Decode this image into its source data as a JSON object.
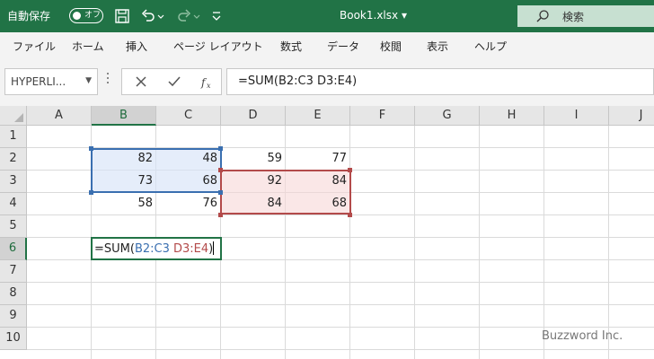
{
  "titlebar": {
    "autosave_label": "自動保存",
    "autosave_state": "オフ",
    "filename": "Book1.xlsx",
    "filename_dropdown": "▾",
    "search_label": "検索",
    "colors": {
      "background": "#217346",
      "text": "#ffffff"
    },
    "icons": [
      "save-icon",
      "undo-icon",
      "undo-dropdown-icon",
      "redo-icon",
      "redo-dropdown-icon",
      "customize-qat-icon",
      "search-icon"
    ]
  },
  "ribbon": {
    "tabs": [
      "ファイル",
      "ホーム",
      "挿入",
      "ページ レイアウト",
      "数式",
      "データ",
      "校閲",
      "表示",
      "ヘルプ"
    ]
  },
  "formula_bar": {
    "name_box": "HYPERLI...",
    "formula": "=SUM(B2:C3 D3:E4)",
    "icons": [
      "cancel-icon",
      "enter-icon",
      "insert-function-icon"
    ]
  },
  "sheet": {
    "columns": [
      "A",
      "B",
      "C",
      "D",
      "E",
      "F",
      "G",
      "H",
      "I",
      "J"
    ],
    "rows": [
      "1",
      "2",
      "3",
      "4",
      "5",
      "6",
      "7",
      "8",
      "9",
      "10"
    ],
    "cells": {
      "B2": "82",
      "C2": "48",
      "D2": "59",
      "E2": "77",
      "B3": "73",
      "C3": "68",
      "D3": "92",
      "E3": "84",
      "B4": "58",
      "C4": "76",
      "D4": "84",
      "E4": "68"
    },
    "editing_cell": {
      "prefix": "=SUM(",
      "ref1": "B2:C3",
      "space": " ",
      "ref2": "D3:E4",
      "suffix": ")"
    },
    "range_colors": {
      "ref1": "#3a6fb0",
      "ref2": "#b34a4a"
    }
  },
  "watermark": "Buzzword Inc."
}
